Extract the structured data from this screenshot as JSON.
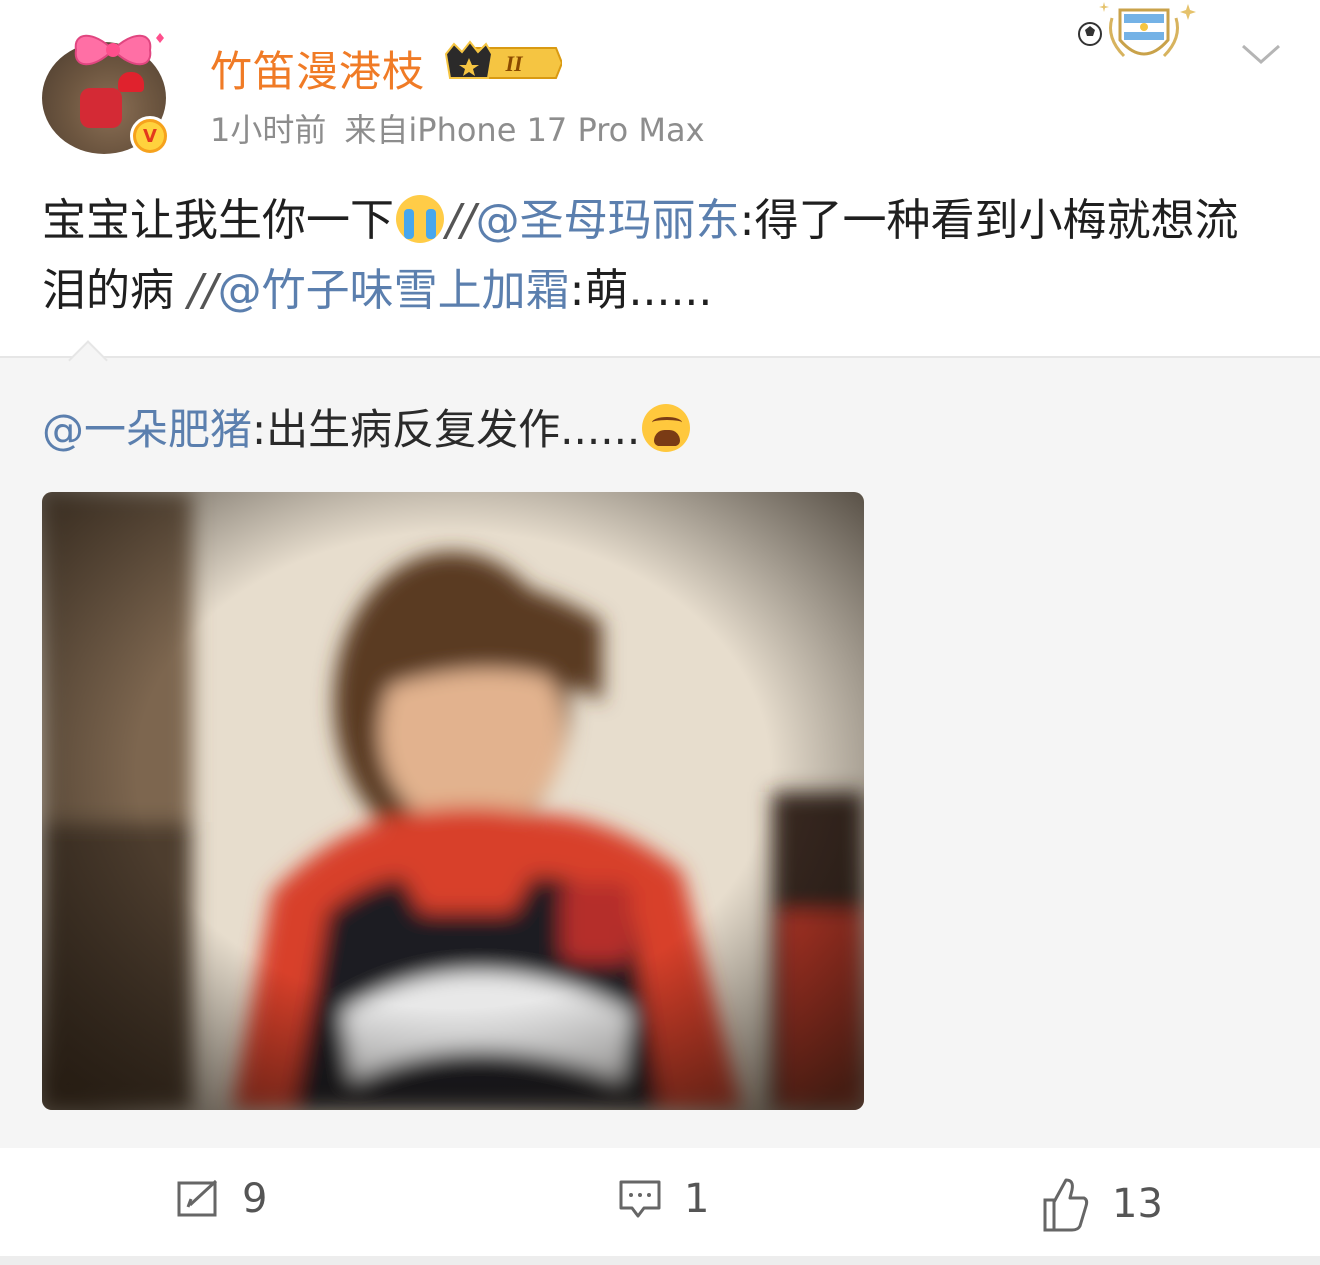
{
  "post": {
    "username": "竹笛漫港枝",
    "time": "1小时前",
    "source": "来自iPhone 17 Pro Max",
    "badge_level": "II",
    "text": {
      "part1": "宝宝让我生你一下",
      "sep1": "//",
      "mention1": "@圣母玛丽东",
      "after_mention1": ":得了一种看到小梅就想流泪的病 ",
      "sep2": "//",
      "mention2": "@竹子味雪上加霜",
      "after_mention2": ":萌......"
    }
  },
  "repost": {
    "mention": "@一朵肥猪",
    "text": ":出生病反复发作......"
  },
  "actions": {
    "repost_count": "9",
    "comment_count": "1",
    "like_count": "13"
  },
  "icons": [
    "avatar",
    "verified-icon",
    "crown-badge-icon",
    "football-badge-icon",
    "chevron-down-icon",
    "crying-emoji-icon",
    "weary-emoji-icon",
    "repost-icon",
    "comment-icon",
    "like-icon"
  ],
  "colors": {
    "username": "#f07b26",
    "mention": "#5b7fae",
    "text": "#1f1f1f",
    "meta": "#8d8d8d",
    "repost_bg": "#f5f5f5"
  }
}
